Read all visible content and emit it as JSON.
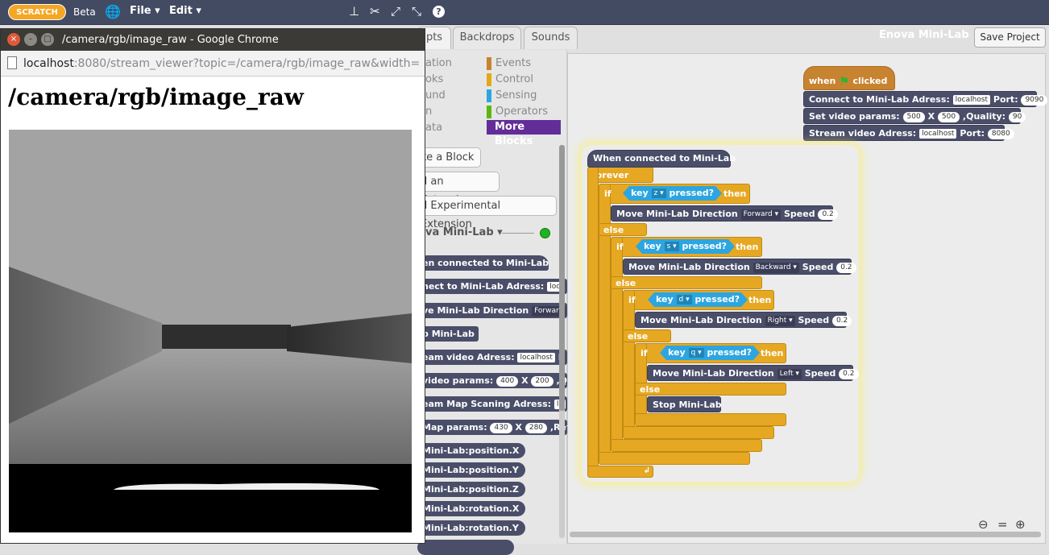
{
  "topbar": {
    "logo": "SCRATCH",
    "beta": "Beta",
    "file": "File",
    "edit": "Edit"
  },
  "tabs": [
    "pts",
    "Backdrops",
    "Sounds"
  ],
  "project": {
    "title": "Enova Mini-Lab",
    "save": "Save Project"
  },
  "categories_left": [
    "ation",
    "oks",
    "und",
    "n",
    "ata"
  ],
  "categories_right": [
    {
      "label": "Events",
      "color": "#c88330"
    },
    {
      "label": "Control",
      "color": "#e1a91a"
    },
    {
      "label": "Sensing",
      "color": "#2ca5e0"
    },
    {
      "label": "Operators",
      "color": "#5cb712"
    }
  ],
  "more_blocks": "More Blocks",
  "palette_buttons": [
    "ke a Block",
    "d an Extension",
    "d Experimental Extension"
  ],
  "extension": {
    "name": "va Mini-Lab",
    "arrow": "▾"
  },
  "palette_blocks": {
    "b1": "en connected to Mini-Lab",
    "b2": "nect to Mini-Lab Adress:",
    "b2f": "loc",
    "b3": "ve Mini-Lab Direction",
    "b3f": "Forward",
    "b4": "p Mini-Lab",
    "b5": "eam video Adress:",
    "b5f": "localhost",
    "b5t": "P",
    "b6a": "video params:",
    "b6n1": "400",
    "b6x": "X",
    "b6n2": "200",
    "b6t": ",Q",
    "b7": "eam Map Scaning Adress:",
    "b7f": "lo",
    "b8a": "Map params:",
    "b8n1": "430",
    "b8x": "X",
    "b8n2": "280",
    "b8t": ",Ref",
    "r1": "Mini-Lab:position.X",
    "r2": "Mini-Lab:position.Y",
    "r3": "Mini-Lab:position.Z",
    "r4": "Mini-Lab:rotation.X",
    "r5": "Mini-Lab:rotation.Y"
  },
  "script1": {
    "when": "when",
    "clicked": "clicked",
    "connect": "Connect to Mini-Lab Adress:",
    "connect_host": "localhost",
    "port": "Port:",
    "connect_port": "9090",
    "setvideo": "Set video params:",
    "w": "500",
    "x": "X",
    "h": "500",
    "quality": ",Quality:",
    "q": "90",
    "stream": "Stream video Adress:",
    "stream_host": "localhost",
    "stream_port": "8080"
  },
  "script2": {
    "hat": "When connected to Mini-Lab",
    "forever": "forever",
    "if": "if",
    "then": "then",
    "else": "else",
    "key": "key",
    "pressed": "pressed?",
    "k1": "z",
    "k2": "s",
    "k3": "d",
    "k4": "q",
    "move": "Move Mini-Lab Direction",
    "speed": "Speed",
    "d1": "Forward",
    "d2": "Backward",
    "d3": "Right",
    "d4": "Left",
    "sp": "0.2",
    "stop": "Stop Mini-Lab"
  },
  "browser": {
    "title": "/camera/rgb/image_raw - Google Chrome",
    "url_host": "localhost",
    "url_rest": ":8080/stream_viewer?topic=/camera/rgb/image_raw&width=",
    "heading": "/camera/rgb/image_raw"
  }
}
